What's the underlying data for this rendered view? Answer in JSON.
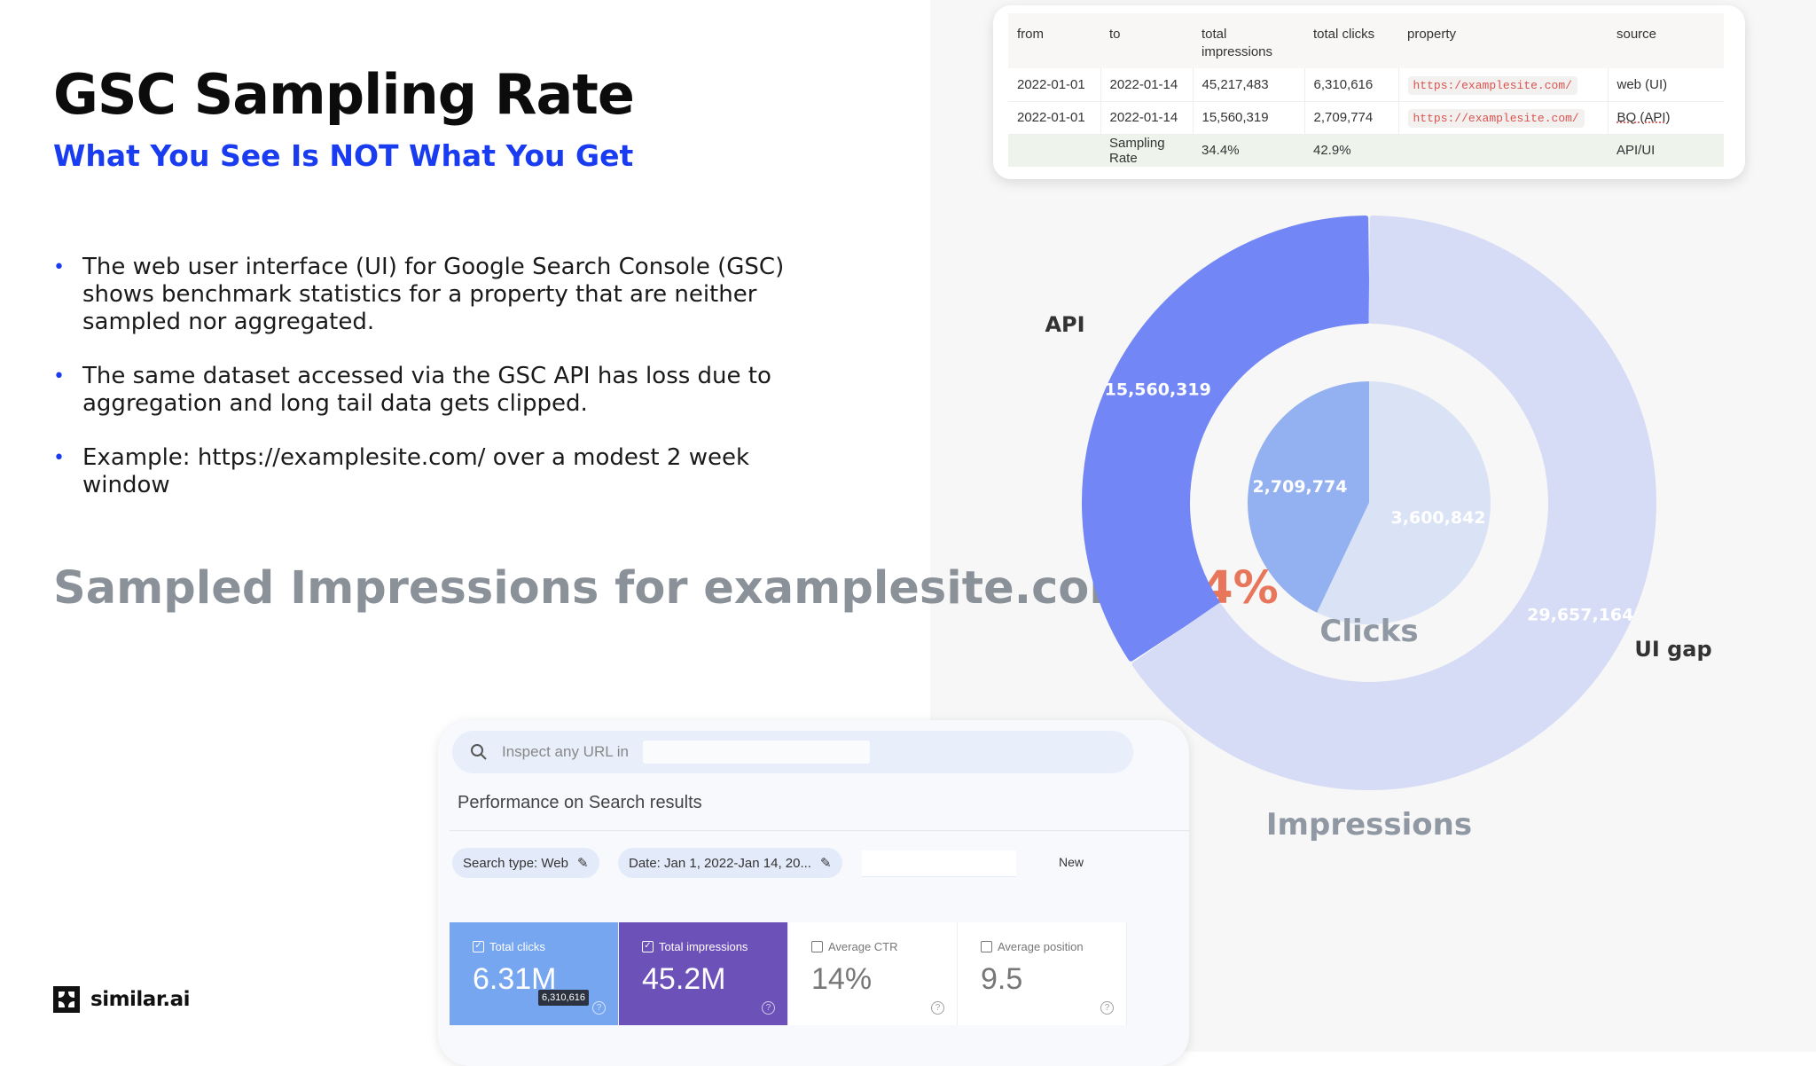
{
  "title": "GSC Sampling Rate",
  "subtitle": "What You See Is NOT What You Get",
  "bullets": [
    "The web user interface (UI) for Google Search Console (GSC) shows benchmark statistics for a property that are neither sampled nor aggregated.",
    "The same dataset accessed via the GSC API has loss due to aggregation and long tail data gets clipped.",
    "Example: https://examplesite.com/ over a modest 2 week window"
  ],
  "sampled": {
    "text": "Sampled Impressions for examplesite.com:",
    "value": "34%"
  },
  "logo": {
    "text": "similar.ai"
  },
  "table": {
    "headers": [
      "from",
      "to",
      "total impressions",
      "total clicks",
      "property",
      "source"
    ],
    "rows": [
      [
        "2022-01-01",
        "2022-01-14",
        "45,217,483",
        "6,310,616",
        "https:/examplesite.com/",
        "web (UI)"
      ],
      [
        "2022-01-01",
        "2022-01-14",
        "15,560,319",
        "2,709,774",
        "https://examplesite.com/",
        "BQ (API)"
      ]
    ],
    "rate_row": [
      "",
      "Sampling Rate",
      "34.4%",
      "42.9%",
      "",
      "API/UI"
    ]
  },
  "chart_data": {
    "type": "pie",
    "rings": [
      {
        "name": "Impressions",
        "slices": [
          {
            "label": "API",
            "value": 15560319,
            "display": "15,560,319",
            "color": "#7286f5"
          },
          {
            "label": "UI gap",
            "value": 29657164,
            "display": "29,657,164",
            "color": "#d6dbf6"
          }
        ]
      },
      {
        "name": "Clicks",
        "slices": [
          {
            "label": "API",
            "value": 2709774,
            "display": "2,709,774",
            "color": "#93b1f0"
          },
          {
            "label": "UI gap",
            "value": 3600842,
            "display": "3,600,842",
            "color": "#dae2f6"
          }
        ]
      }
    ],
    "legend_labels": {
      "api": "API",
      "gap": "UI gap"
    }
  },
  "gsc": {
    "search_placeholder": "Inspect any URL in",
    "perf_title": "Performance on Search results",
    "chips": [
      "Search type: Web",
      "Date: Jan 1, 2022-Jan 14, 20..."
    ],
    "new_label": "New",
    "metrics": [
      {
        "label": "Total clicks",
        "value": "6.31M",
        "checked": true,
        "bg": "#76a6f0",
        "fg": "#ffffff"
      },
      {
        "label": "Total impressions",
        "value": "45.2M",
        "checked": true,
        "bg": "#6c51b8",
        "fg": "#ffffff"
      },
      {
        "label": "Average CTR",
        "value": "14%",
        "checked": false,
        "bg": "#ffffff",
        "fg": "#777777"
      },
      {
        "label": "Average position",
        "value": "9.5",
        "checked": false,
        "bg": "#ffffff",
        "fg": "#777777"
      }
    ],
    "tooltip": "6,310,616"
  }
}
